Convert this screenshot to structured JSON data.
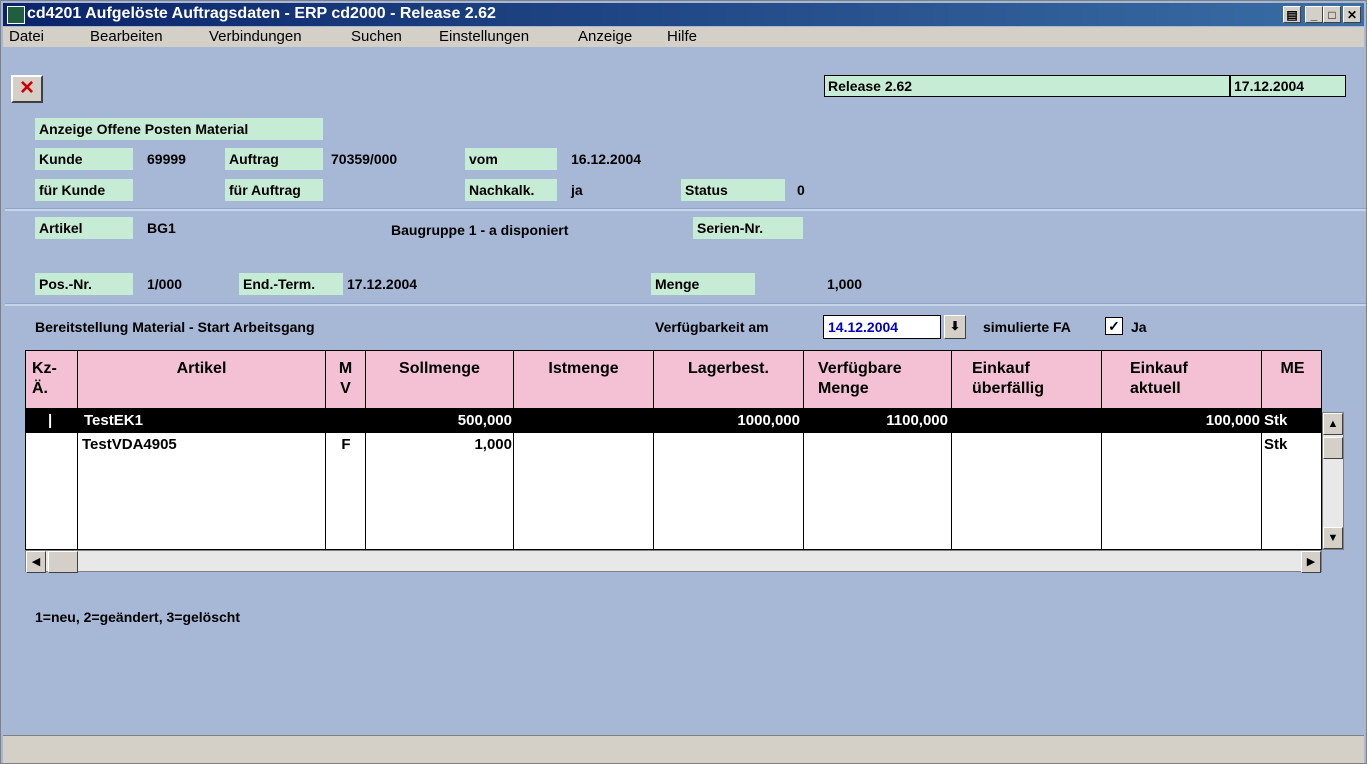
{
  "window": {
    "title": "cd4201 Aufgelöste Auftragsdaten - ERP cd2000 - Release 2.62",
    "controls": [
      "print",
      "minimize",
      "maximize",
      "close"
    ]
  },
  "menu": [
    "Datei",
    "Bearbeiten",
    "Verbindungen",
    "Suchen",
    "Einstellungen",
    "Anzeige",
    "Hilfe"
  ],
  "toolbar": {
    "close_icon": "×"
  },
  "release": {
    "label": "Release 2.62",
    "date": "17.12.2004"
  },
  "header": {
    "title": "Anzeige Offene Posten Material",
    "kunde_label": "Kunde",
    "kunde_value": "69999",
    "auftrag_label": "Auftrag",
    "auftrag_value": "70359/000",
    "vom_label": "vom",
    "vom_value": "16.12.2004",
    "fuer_kunde_label": "für Kunde",
    "fuer_auftrag_label": "für Auftrag",
    "nachkalk_label": "Nachkalk.",
    "nachkalk_value": "ja",
    "status_label": "Status",
    "status_value": "0"
  },
  "artikel": {
    "artikel_label": "Artikel",
    "artikel_value": "BG1",
    "bezeichnung": "Baugruppe 1 - a disponiert",
    "serien_label": "Serien-Nr.",
    "pos_label": "Pos.-Nr.",
    "pos_value": "1/000",
    "endterm_label": "End.-Term.",
    "endterm_value": "17.12.2004",
    "menge_label": "Menge",
    "menge_value": "1,000"
  },
  "section": {
    "title": "Bereitstellung Material - Start Arbeitsgang",
    "verfuegbarkeit_label": "Verfügbarkeit am",
    "verfuegbarkeit_date": "14.12.2004",
    "simulierte_label": "simulierte FA",
    "simulierte_checked": "✓",
    "ja_label": "Ja"
  },
  "grid": {
    "headers": [
      "Kz-\nÄ.",
      "Artikel",
      "M\nV",
      "Sollmenge",
      "Istmenge",
      "Lagerbest.",
      "Verfügbare\nMenge",
      "Einkauf\nüberfällig",
      "Einkauf\naktuell",
      "ME"
    ],
    "rows": [
      [
        "|",
        "TestEK1",
        "",
        "500,000",
        "",
        "1000,000",
        "1100,000",
        "",
        "100,000",
        "Stk"
      ],
      [
        "",
        "TestVDA4905",
        "F",
        "1,000",
        "",
        "",
        "",
        "",
        "",
        "Stk"
      ]
    ]
  },
  "legend": "1=neu, 2=geändert, 3=gelöscht"
}
